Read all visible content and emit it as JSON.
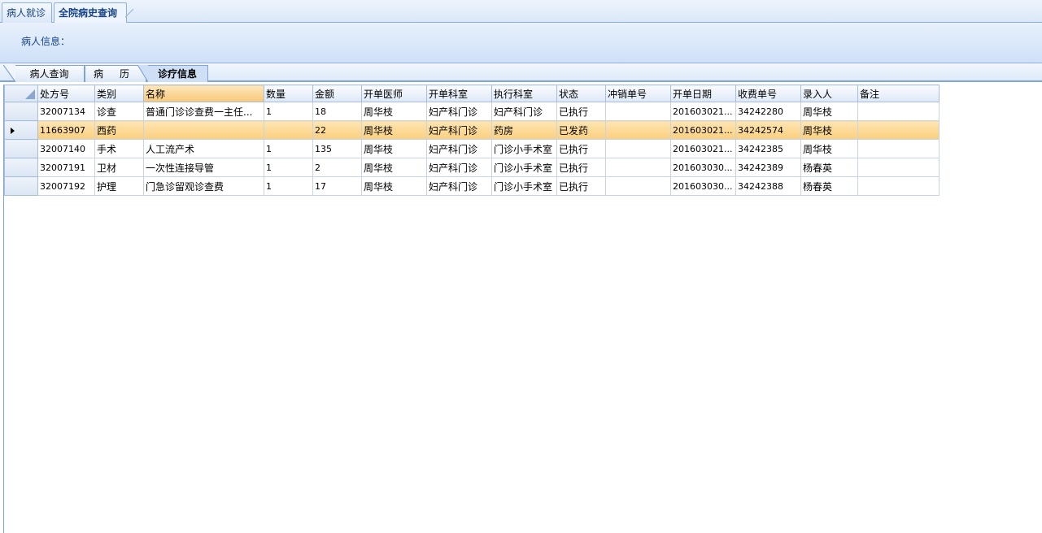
{
  "top_tabs": [
    {
      "label": "病人就诊"
    },
    {
      "label": "全院病史查询"
    }
  ],
  "info": {
    "patient_label": "病人信息："
  },
  "inner_tabs": [
    {
      "label": "病人查询"
    },
    {
      "label": "病历"
    },
    {
      "label": "诊疗信息"
    }
  ],
  "grid": {
    "columns": [
      "处方号",
      "类别",
      "名称",
      "数量",
      "金额",
      "开单医师",
      "开单科室",
      "执行科室",
      "状态",
      "冲销单号",
      "开单日期",
      "收费单号",
      "录入人",
      "备注"
    ],
    "rows": [
      [
        "32007134",
        "诊查",
        "普通门诊诊查费一主任...",
        "1",
        "18",
        "周华枝",
        "妇产科门诊",
        "妇产科门诊",
        "已执行",
        "",
        "201603021...",
        "34242280",
        "周华枝",
        ""
      ],
      [
        "11663907",
        "西药",
        "",
        "",
        "22",
        "周华枝",
        "妇产科门诊",
        "药房",
        "已发药",
        "",
        "201603021...",
        "34242574",
        "周华枝",
        ""
      ],
      [
        "32007140",
        "手术",
        "人工流产术",
        "1",
        "135",
        "周华枝",
        "妇产科门诊",
        "门诊小手术室",
        "已执行",
        "",
        "201603021...",
        "34242385",
        "周华枝",
        ""
      ],
      [
        "32007191",
        "卫材",
        "一次性连接导管",
        "1",
        "2",
        "周华枝",
        "妇产科门诊",
        "门诊小手术室",
        "已执行",
        "",
        "201603030...",
        "34242389",
        "杨春英",
        ""
      ],
      [
        "32007192",
        "护理",
        "门急诊留观诊查费",
        "1",
        "17",
        "周华枝",
        "妇产科门诊",
        "门诊小手术室",
        "已执行",
        "",
        "201603030...",
        "34242388",
        "杨春英",
        ""
      ]
    ],
    "selected_row": 1
  }
}
